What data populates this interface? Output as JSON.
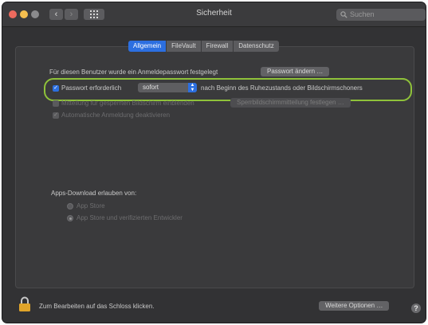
{
  "window": {
    "title": "Sicherheit"
  },
  "toolbar": {
    "back_glyph": "‹",
    "forward_glyph": "›",
    "search_placeholder": "Suchen"
  },
  "tabs": [
    {
      "label": "Allgemein",
      "active": true
    },
    {
      "label": "FileVault",
      "active": false
    },
    {
      "label": "Firewall",
      "active": false
    },
    {
      "label": "Datenschutz",
      "active": false
    }
  ],
  "login": {
    "text": "Für diesen Benutzer wurde ein Anmeldepasswort festgelegt",
    "change_password_button": "Passwort ändern …"
  },
  "require_password": {
    "checked": true,
    "label": "Passwort erforderlich",
    "delay_value": "sofort",
    "suffix": "nach Beginn des Ruhezustands oder Bildschirmschoners"
  },
  "lock_message": {
    "checked": false,
    "label": "Mitteilung für gesperrten Bildschirm einblenden",
    "button": "Sperrbildschirmmitteilung festlegen …"
  },
  "auto_login": {
    "checked": true,
    "label": "Automatische Anmeldung deaktivieren"
  },
  "apps_download": {
    "heading": "Apps-Download erlauben von:",
    "options": [
      {
        "label": "App Store",
        "selected": false
      },
      {
        "label": "App Store und verifizierten Entwickler",
        "selected": true
      }
    ]
  },
  "footer": {
    "lock_text": "Zum Bearbeiten auf das Schloss klicken.",
    "advanced_button": "Weitere Optionen …",
    "help_glyph": "?"
  },
  "colors": {
    "accent": "#2c6fe0",
    "highlight_ring": "#8fc23a",
    "lock": "#e0a42a"
  }
}
